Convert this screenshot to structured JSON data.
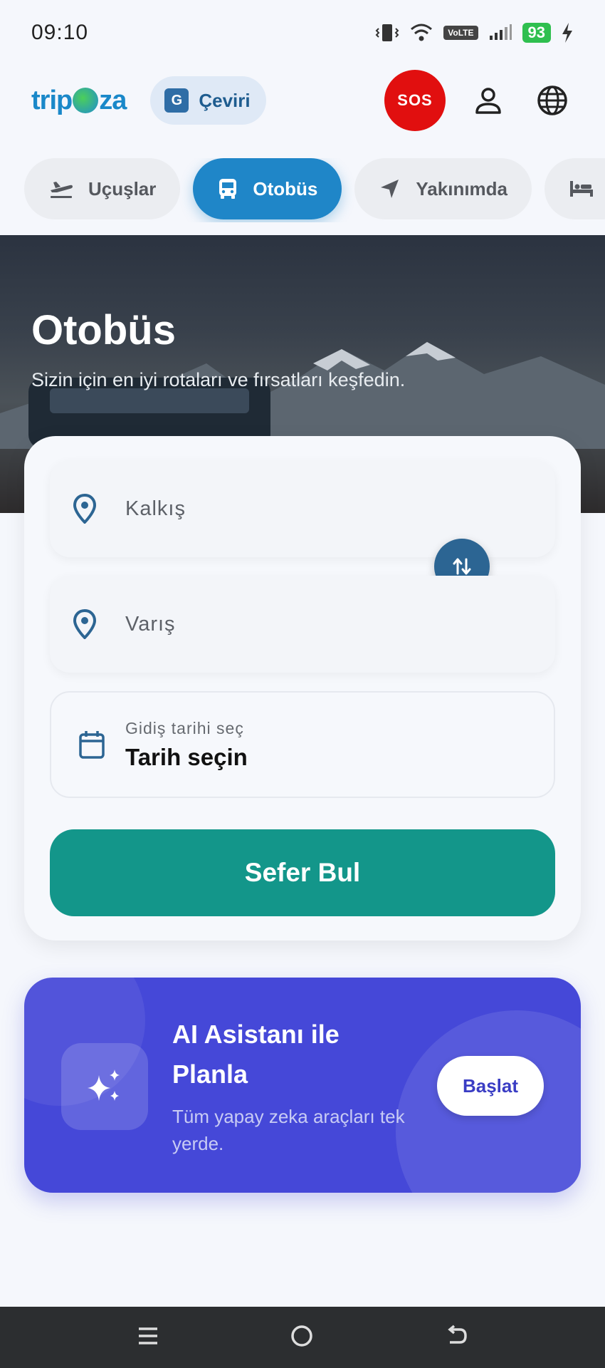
{
  "status_bar": {
    "time": "09:10",
    "volte": "VoLTE",
    "battery": "93"
  },
  "header": {
    "logo_prefix": "trip",
    "logo_suffix": "za",
    "translate_label": "Çeviri",
    "translate_icon_glyph": "G",
    "sos_label": "SOS"
  },
  "tabs": [
    {
      "label": "Uçuşlar",
      "icon": "plane-icon"
    },
    {
      "label": "Otobüs",
      "icon": "bus-icon"
    },
    {
      "label": "Yakınımda",
      "icon": "navigation-arrow-icon"
    },
    {
      "label": "",
      "icon": "bed-icon"
    }
  ],
  "hero": {
    "title": "Otobüs",
    "subtitle": "Sizin için en iyi rotaları ve fırsatları keşfedin."
  },
  "search": {
    "from_placeholder": "Kalkış",
    "to_placeholder": "Varış",
    "date_label": "Gidiş tarihi seç",
    "date_value": "Tarih seçin",
    "cta_label": "Sefer Bul"
  },
  "ai_card": {
    "title": "AI Asistanı ile Planla",
    "subtitle": "Tüm yapay zeka araçları tek yerde.",
    "button_label": "Başlat"
  },
  "colors": {
    "accent": "#1f86c8",
    "cta": "#13968a",
    "sos": "#e10f0f",
    "ai_card": "#4548d8",
    "icon_blue": "#2c6593"
  }
}
